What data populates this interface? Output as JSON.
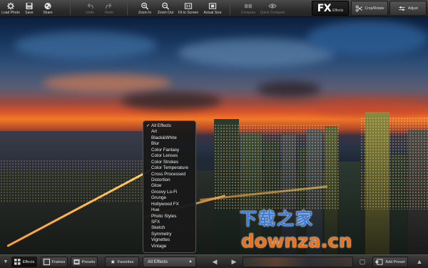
{
  "toolbar": {
    "load_photo": "Load Photo",
    "save": "Save",
    "share": "Share",
    "undo": "Undo",
    "redo": "Redo",
    "zoom_in": "Zoom In",
    "zoom_out": "Zoom Out",
    "fit_to_screen": "Fit to Screen",
    "actual_size": "Actual Size",
    "compare": "Compare",
    "quick_compare": "Quick Compare",
    "fx_mark": "FX",
    "effects": "Effects",
    "crop_rotate": "Crop/Rotate",
    "adjust": "Adjust"
  },
  "dropdown": {
    "selected": "All Effects",
    "items": [
      "All Effects",
      "Art",
      "Black&White",
      "Blur",
      "Color Fantasy",
      "Color Lenses",
      "Color Strokes",
      "Color Temperature",
      "Cross Processed",
      "Distortion",
      "Glow",
      "Groovy Lo-Fi",
      "Grunge",
      "Hollywood FX",
      "Hue",
      "Photo Styles",
      "SFX",
      "Sketch",
      "Symmetry",
      "Vignettes",
      "Vintage"
    ]
  },
  "bottombar": {
    "effects": "Effects",
    "frames": "Frames",
    "presets": "Presets",
    "favorites": "Favorites",
    "category_value": "All Effects",
    "add_preset": "Add Preset"
  },
  "watermark": {
    "cn": "下载之家",
    "en": "downza.cn"
  },
  "colors": {
    "toolbar_bg": "#2c2c2c",
    "watermark_blue": "#3b7bd9",
    "watermark_orange": "#e8731f"
  }
}
